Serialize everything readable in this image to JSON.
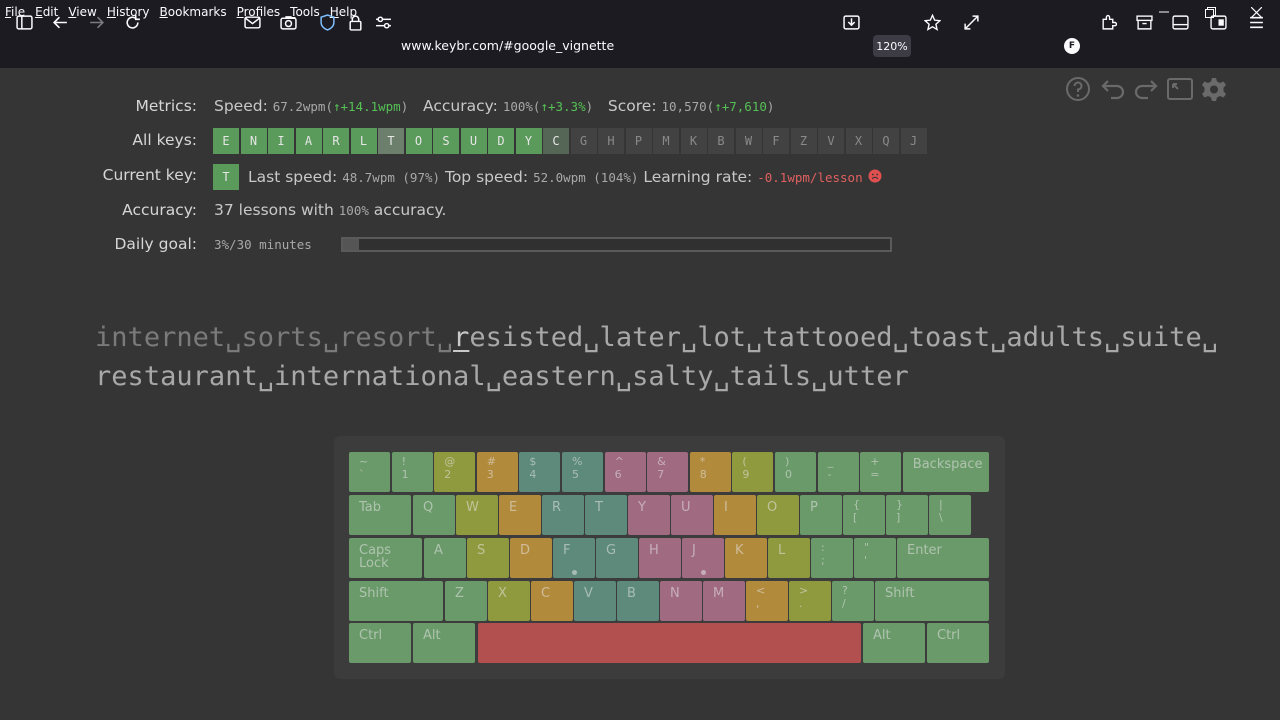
{
  "menu": [
    "File",
    "Edit",
    "View",
    "History",
    "Bookmarks",
    "Profiles",
    "Tools",
    "Help"
  ],
  "menu_accel": [
    "F",
    "E",
    "V",
    "H",
    "B",
    "P",
    "T",
    "H"
  ],
  "url": "www.keybr.com/#google_vignette",
  "zoom": "120%",
  "profile_letter": "F",
  "metrics": {
    "label": "Metrics:",
    "speed_label": "Speed:",
    "speed": "67.2wpm",
    "speed_delta": "↑+14.1wpm",
    "accuracy_label": "Accuracy:",
    "accuracy": "100%",
    "accuracy_delta": "↑+3.3%",
    "score_label": "Score:",
    "score": "10,570",
    "score_delta": "↑+7,610"
  },
  "all_keys": {
    "label": "All keys:",
    "keys": [
      {
        "k": "E",
        "s": "done"
      },
      {
        "k": "N",
        "s": "done"
      },
      {
        "k": "I",
        "s": "done"
      },
      {
        "k": "A",
        "s": "done"
      },
      {
        "k": "R",
        "s": "done"
      },
      {
        "k": "L",
        "s": "done"
      },
      {
        "k": "T",
        "s": "cur"
      },
      {
        "k": "O",
        "s": "done"
      },
      {
        "k": "S",
        "s": "done"
      },
      {
        "k": "U",
        "s": "done"
      },
      {
        "k": "D",
        "s": "done"
      },
      {
        "k": "Y",
        "s": "done"
      },
      {
        "k": "C",
        "s": "part"
      },
      {
        "k": "G",
        "s": "off"
      },
      {
        "k": "H",
        "s": "off"
      },
      {
        "k": "P",
        "s": "off"
      },
      {
        "k": "M",
        "s": "off"
      },
      {
        "k": "K",
        "s": "off"
      },
      {
        "k": "B",
        "s": "off"
      },
      {
        "k": "W",
        "s": "off"
      },
      {
        "k": "F",
        "s": "off"
      },
      {
        "k": "Z",
        "s": "off"
      },
      {
        "k": "V",
        "s": "off"
      },
      {
        "k": "X",
        "s": "off"
      },
      {
        "k": "Q",
        "s": "off"
      },
      {
        "k": "J",
        "s": "off"
      }
    ]
  },
  "current_key": {
    "label": "Current key:",
    "key": "T",
    "last_speed_label": "Last speed:",
    "last_speed": "48.7wpm (97%)",
    "top_speed_label": "Top speed:",
    "top_speed": "52.0wpm (104%)",
    "learning_rate_label": "Learning rate:",
    "learning_rate": "-0.1wpm/lesson"
  },
  "accuracy_row": {
    "label": "Accuracy:",
    "pre": "37 lessons with ",
    "pct": "100%",
    "post": " accuracy."
  },
  "daily_goal": {
    "label": "Daily goal:",
    "value": "3%/30 minutes",
    "progress": 0.03
  },
  "text": {
    "line1_typed": "internet␣sorts␣resort␣",
    "line1_cursor": "r",
    "line1_rest": "esisted␣later␣lot␣tattooed␣toast␣adults␣suite␣",
    "line2": "restaurant␣international␣eastern␣salty␣tails␣utter"
  },
  "keyboard": {
    "row1": [
      {
        "t": "~",
        "b": "`",
        "c": "g"
      },
      {
        "t": "!",
        "b": "1",
        "c": "g"
      },
      {
        "t": "@",
        "b": "2",
        "c": "y"
      },
      {
        "t": "#",
        "b": "3",
        "c": "o"
      },
      {
        "t": "$",
        "b": "4",
        "c": "tl"
      },
      {
        "t": "%",
        "b": "5",
        "c": "tl"
      },
      {
        "t": "^",
        "b": "6",
        "c": "p"
      },
      {
        "t": "&",
        "b": "7",
        "c": "p"
      },
      {
        "t": "*",
        "b": "8",
        "c": "o"
      },
      {
        "t": "(",
        "b": "9",
        "c": "y"
      },
      {
        "t": ")",
        "b": "0",
        "c": "g"
      },
      {
        "t": "_",
        "b": "-",
        "c": "g"
      },
      {
        "t": "+",
        "b": "=",
        "c": "g"
      }
    ],
    "backspace": "Backspace",
    "tab": "Tab",
    "row2": [
      {
        "t": "Q",
        "c": "g"
      },
      {
        "t": "W",
        "c": "y"
      },
      {
        "t": "E",
        "c": "o"
      },
      {
        "t": "R",
        "c": "tl"
      },
      {
        "t": "T",
        "c": "tl"
      },
      {
        "t": "Y",
        "c": "p"
      },
      {
        "t": "U",
        "c": "p"
      },
      {
        "t": "I",
        "c": "o"
      },
      {
        "t": "O",
        "c": "y"
      },
      {
        "t": "P",
        "c": "g"
      },
      {
        "t": "{",
        "b": "[",
        "c": "g"
      },
      {
        "t": "}",
        "b": "]",
        "c": "g"
      },
      {
        "t": "|",
        "b": "\\",
        "c": "g"
      }
    ],
    "caps": "Caps Lock",
    "row3": [
      {
        "t": "A",
        "c": "g"
      },
      {
        "t": "S",
        "c": "y"
      },
      {
        "t": "D",
        "c": "o"
      },
      {
        "t": "F",
        "c": "tl"
      },
      {
        "t": "G",
        "c": "tl"
      },
      {
        "t": "H",
        "c": "p"
      },
      {
        "t": "J",
        "c": "p"
      },
      {
        "t": "K",
        "c": "o"
      },
      {
        "t": "L",
        "c": "y"
      },
      {
        "t": ":",
        "b": ";",
        "c": "g"
      },
      {
        "t": "\"",
        "b": "'",
        "c": "g"
      }
    ],
    "enter": "Enter",
    "shift": "Shift",
    "row4": [
      {
        "t": "Z",
        "c": "g"
      },
      {
        "t": "X",
        "c": "y"
      },
      {
        "t": "C",
        "c": "o"
      },
      {
        "t": "V",
        "c": "tl"
      },
      {
        "t": "B",
        "c": "tl"
      },
      {
        "t": "N",
        "c": "p"
      },
      {
        "t": "M",
        "c": "p"
      },
      {
        "t": "<",
        "b": ",",
        "c": "o"
      },
      {
        "t": ">",
        "b": ".",
        "c": "y"
      },
      {
        "t": "?",
        "b": "/",
        "c": "g"
      }
    ],
    "ctrl": "Ctrl",
    "alt": "Alt"
  }
}
